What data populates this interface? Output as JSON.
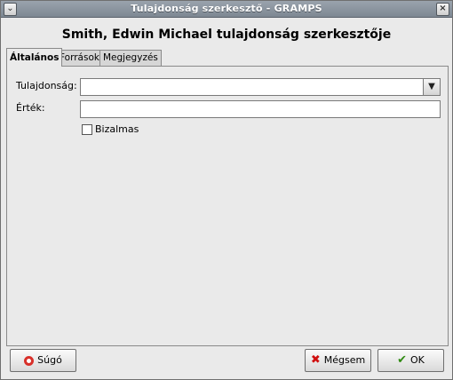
{
  "window": {
    "title": "Tulajdonság szerkesztő - GRAMPS"
  },
  "heading": "Smith, Edwin Michael tulajdonság szerkesztője",
  "tabs": [
    {
      "label": "Általános",
      "active": true
    },
    {
      "label": "Források",
      "active": false
    },
    {
      "label": "Megjegyzés",
      "active": false
    }
  ],
  "form": {
    "property_label": "Tulajdonság:",
    "property_value": "",
    "value_label": "Érték:",
    "value_value": "",
    "private_label": "Bizalmas",
    "private_checked": false
  },
  "buttons": {
    "help": "Súgó",
    "cancel": "Mégsem",
    "ok": "OK"
  },
  "icons": {
    "menu": "chevron-down-icon",
    "close": "close-icon",
    "combo": "chevron-down-icon",
    "help": "lifebuoy-icon",
    "cancel": "x-icon",
    "ok": "checkmark-icon"
  }
}
